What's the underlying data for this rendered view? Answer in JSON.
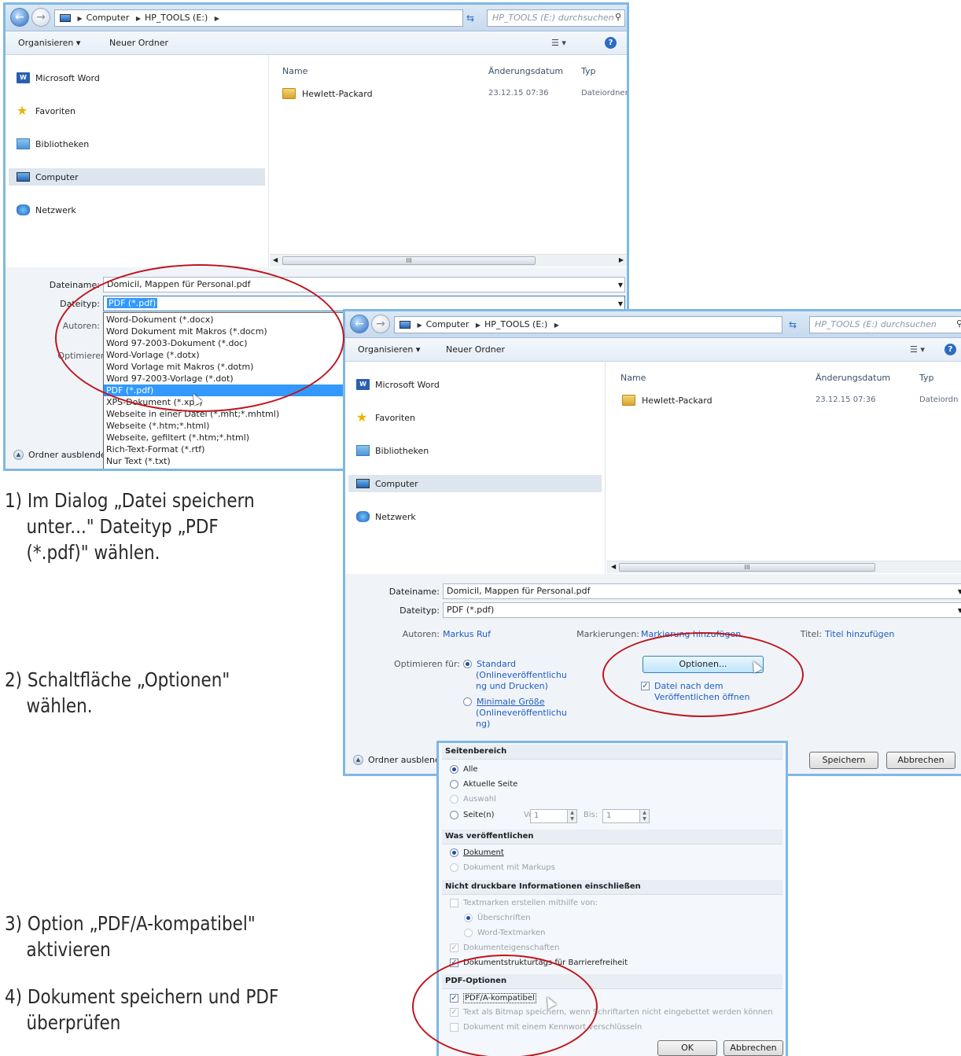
{
  "window": {
    "breadcrumb": [
      "Computer",
      "HP_TOOLS (E:)"
    ],
    "search_placeholder": "HP_TOOLS (E:) durchsuchen",
    "toolbar": {
      "organize": "Organisieren",
      "new_folder": "Neuer Ordner"
    },
    "nav": [
      "Microsoft Word",
      "Favoriten",
      "Bibliotheken",
      "Computer",
      "Netzwerk"
    ],
    "columns": {
      "name": "Name",
      "date": "Änderungsdatum",
      "type": "Typ"
    },
    "files": [
      {
        "name": "Hewlett-Packard",
        "date": "23.12.15 07:36",
        "type": "Dateiordner"
      }
    ],
    "filename_label": "Dateiname:",
    "filename": "Domicil, Mappen für Personal.pdf",
    "filetype_label": "Dateityp:",
    "filetype": "PDF (*.pdf)",
    "authors_label": "Autoren:",
    "optimize_label": "Optimieren",
    "hide_folders": "Ordner ausblende",
    "filetype_options": [
      "Word-Dokument (*.docx)",
      "Word Dokument mit Makros (*.docm)",
      "Word 97-2003-Dokument (*.doc)",
      "Word-Vorlage (*.dotx)",
      "Word Vorlage mit Makros (*.dotm)",
      "Word 97-2003-Vorlage (*.dot)",
      "PDF (*.pdf)",
      "XPS-Dokument (*.xps)",
      "Webseite in einer Datei (*.mht;*.mhtml)",
      "Webseite (*.htm;*.html)",
      "Webseite, gefiltert (*.htm;*.html)",
      "Rich-Text-Format (*.rtf)",
      "Nur Text (*.txt)"
    ]
  },
  "window2": {
    "breadcrumb": [
      "Computer",
      "HP_TOOLS (E:)"
    ],
    "search_placeholder": "HP_TOOLS (E:) durchsuchen",
    "toolbar": {
      "organize": "Organisieren",
      "new_folder": "Neuer Ordner"
    },
    "nav": [
      "Microsoft Word",
      "Favoriten",
      "Bibliotheken",
      "Computer",
      "Netzwerk"
    ],
    "columns": {
      "name": "Name",
      "date": "Änderungsdatum",
      "type": "Typ"
    },
    "files": [
      {
        "name": "Hewlett-Packard",
        "date": "23.12.15 07:36",
        "type": "Dateiordn"
      }
    ],
    "filename_label": "Dateiname:",
    "filename": "Domicil, Mappen für Personal.pdf",
    "filetype_label": "Dateityp:",
    "filetype": "PDF (*.pdf)",
    "authors_label": "Autoren:",
    "authors": "Markus Ruf",
    "tags_label": "Markierungen:",
    "tags": "Markierung hinzufügen",
    "title_label": "Titel:",
    "title": "Titel hinzufügen",
    "optimize_label": "Optimieren für:",
    "opt_standard": "Standard",
    "opt_standard_desc": [
      "(Onlineveröffentlichu",
      "ng und Drucken)"
    ],
    "opt_min": "Minimale Größe",
    "opt_min_desc": [
      "(Onlineveröffentlichu",
      "ng)"
    ],
    "options_button": "Optionen...",
    "open_after": [
      "Datei nach dem",
      "Veröffentlichen öffnen"
    ],
    "hide_folders": "Ordner ausblend",
    "save": "Speichern",
    "cancel": "Abbrechen"
  },
  "options": {
    "range_title": "Seitenbereich",
    "all": "Alle",
    "current": "Aktuelle Seite",
    "selection": "Auswahl",
    "pages": "Seite(n)",
    "from": "Von:",
    "from_val": "1",
    "to": "Bis:",
    "to_val": "1",
    "publish_title": "Was veröffentlichen",
    "document": "Dokument",
    "markup": "Dokument mit Markups",
    "nonprint_title": "Nicht druckbare Informationen einschließen",
    "bookmarks": "Textmarken erstellen mithilfe von:",
    "headings": "Überschriften",
    "word_bookmarks": "Word-Textmarken",
    "props": "Dokumenteigenschaften",
    "structure": "Dokumentstrukturtags für Barrierefreiheit",
    "pdf_title": "PDF-Optionen",
    "pdfa": "PDF/A-kompatibel",
    "bitmap": "Text als Bitmap speichern, wenn Schriftarten nicht eingebettet werden können",
    "encrypt": "Dokument mit einem Kennwort verschlüsseln",
    "ok": "OK",
    "cancel": "Abbrechen"
  },
  "steps": {
    "s1": [
      "1) Im Dialog „Datei speichern",
      "unter...\" Dateityp „PDF",
      "(*.pdf)\" wählen."
    ],
    "s2": [
      "2) Schaltfläche „Optionen\"",
      "wählen."
    ],
    "s3": [
      "3) Option „PDF/A-kompatibel\"",
      "aktivieren"
    ],
    "s4": [
      "4) Dokument speichern und PDF",
      "überprüfen"
    ]
  },
  "colors": {
    "annotation": "#c0151b",
    "window_border": "#7fb8e4",
    "selection": "#3399ff",
    "link": "#1f5cc0"
  }
}
